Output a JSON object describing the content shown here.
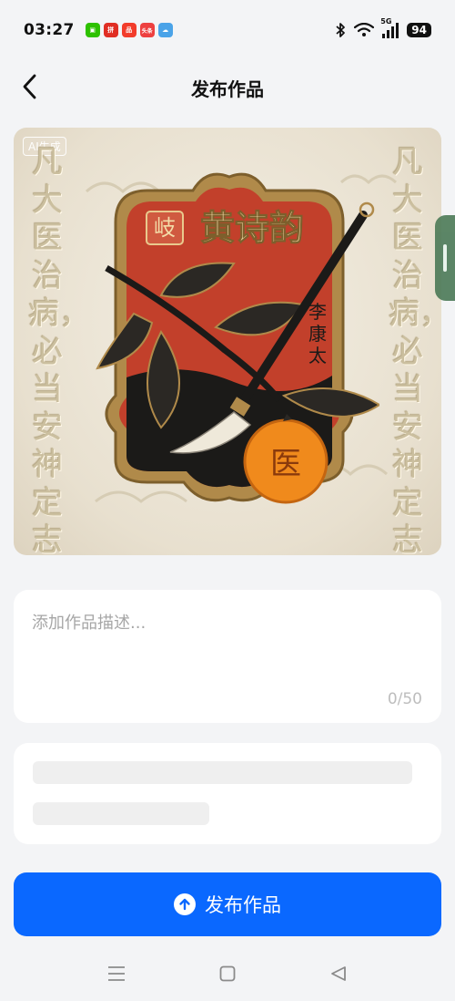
{
  "status_bar": {
    "time": "03:27",
    "network": "5G",
    "battery": "94",
    "apps": [
      {
        "name": "wechat-icon",
        "color": "#2dc100",
        "glyph": "▣"
      },
      {
        "name": "pinduoduo-icon",
        "color": "#e02e24",
        "glyph": "拼"
      },
      {
        "name": "shopping-icon",
        "color": "#f23c2b",
        "glyph": "品"
      },
      {
        "name": "toutiao-icon",
        "color": "#ed4040",
        "glyph": "头条"
      },
      {
        "name": "weather-icon",
        "color": "#4aa3e8",
        "glyph": "☁"
      }
    ]
  },
  "header": {
    "title": "发布作品"
  },
  "artwork": {
    "ai_badge": "AI生成",
    "left_column": "凡大医治病，",
    "right_column": "凡大医治病，必当安神定志",
    "left_column_lower": "必当安神定志",
    "seal_char": "岐",
    "name": "黄诗韵",
    "author": "李康太",
    "orange_char": "医",
    "colors": {
      "red_field": "#c2402b",
      "gold_frame": "#b08a4a",
      "ink": "#1b1a18",
      "orange": "#f08a1c"
    }
  },
  "description": {
    "placeholder": "添加作品描述...",
    "value": "",
    "counter": "0/50"
  },
  "publish": {
    "label": "发布作品"
  },
  "system_nav": {
    "menu_icon": "menu-icon",
    "home_icon": "home-icon",
    "back_icon": "back-triangle-icon"
  }
}
